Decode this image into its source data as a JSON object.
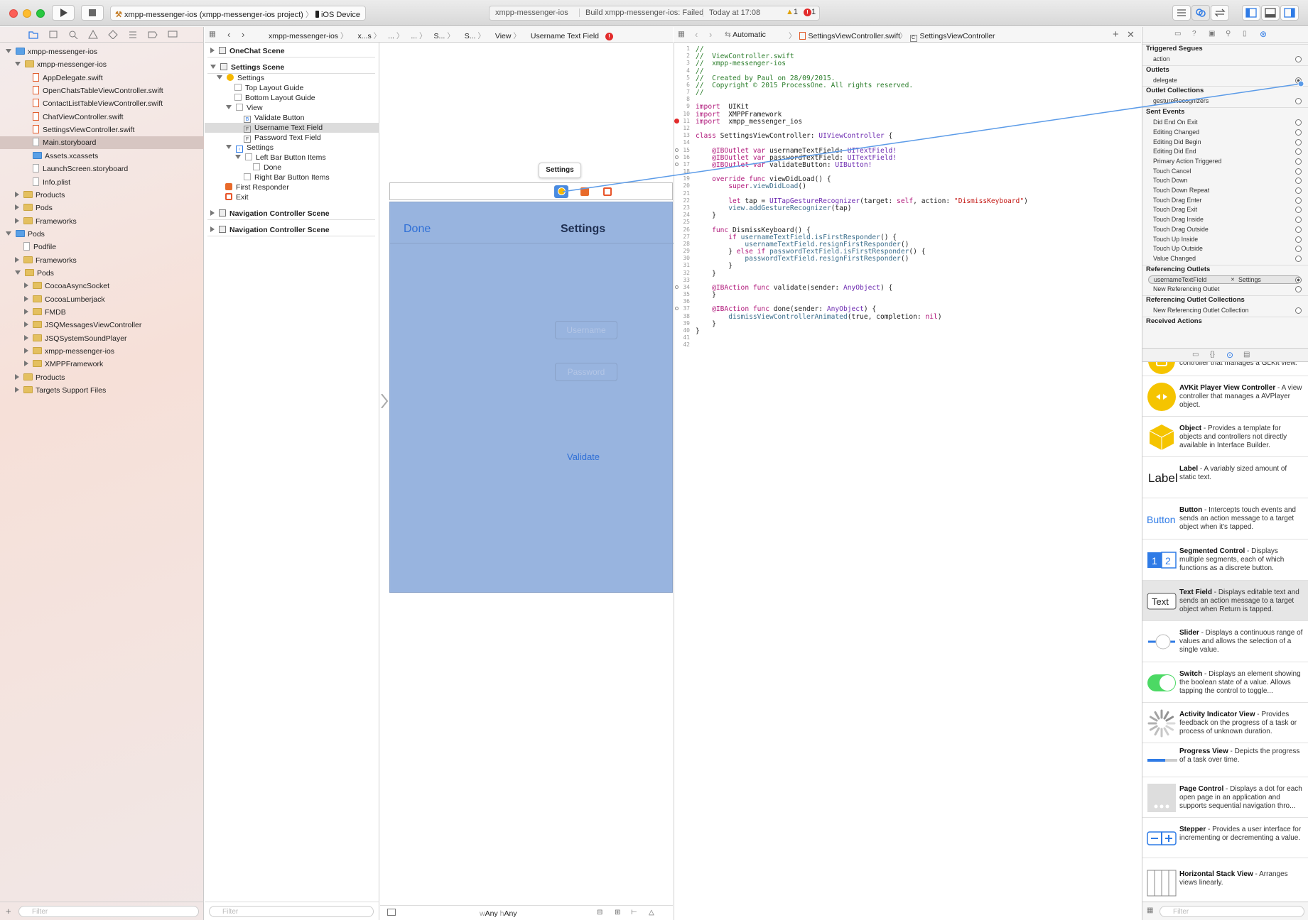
{
  "toolbar": {
    "scheme": "xmpp-messenger-ios (xmpp-messenger-ios project)",
    "device": "iOS Device",
    "activity_project": "xmpp-messenger-ios",
    "activity_status": "Build xmpp-messenger-ios: Failed",
    "activity_time": "Today at 17:08",
    "warnings": "1",
    "errors": "1"
  },
  "navigator": {
    "items": [
      {
        "label": "xmpp-messenger-ios",
        "depth": 0,
        "kind": "project",
        "tri": "open"
      },
      {
        "label": "xmpp-messenger-ios",
        "depth": 1,
        "kind": "folder",
        "tri": "open"
      },
      {
        "label": "AppDelegate.swift",
        "depth": 2,
        "kind": "swift"
      },
      {
        "label": "OpenChatsTableViewController.swift",
        "depth": 2,
        "kind": "swift"
      },
      {
        "label": "ContactListTableViewController.swift",
        "depth": 2,
        "kind": "swift"
      },
      {
        "label": "ChatViewController.swift",
        "depth": 2,
        "kind": "swift"
      },
      {
        "label": "SettingsViewController.swift",
        "depth": 2,
        "kind": "swift"
      },
      {
        "label": "Main.storyboard",
        "depth": 2,
        "kind": "file",
        "selected": true
      },
      {
        "label": "Assets.xcassets",
        "depth": 2,
        "kind": "bluefolder"
      },
      {
        "label": "LaunchScreen.storyboard",
        "depth": 2,
        "kind": "file"
      },
      {
        "label": "Info.plist",
        "depth": 2,
        "kind": "file"
      },
      {
        "label": "Products",
        "depth": 1,
        "kind": "folder",
        "tri": "closed"
      },
      {
        "label": "Pods",
        "depth": 1,
        "kind": "folder",
        "tri": "closed"
      },
      {
        "label": "Frameworks",
        "depth": 1,
        "kind": "folder",
        "tri": "closed"
      },
      {
        "label": "Pods",
        "depth": 0,
        "kind": "project",
        "tri": "open"
      },
      {
        "label": "Podfile",
        "depth": 1,
        "kind": "file"
      },
      {
        "label": "Frameworks",
        "depth": 1,
        "kind": "folder",
        "tri": "closed"
      },
      {
        "label": "Pods",
        "depth": 1,
        "kind": "folder",
        "tri": "open"
      },
      {
        "label": "CocoaAsyncSocket",
        "depth": 2,
        "kind": "folder",
        "tri": "closed"
      },
      {
        "label": "CocoaLumberjack",
        "depth": 2,
        "kind": "folder",
        "tri": "closed"
      },
      {
        "label": "FMDB",
        "depth": 2,
        "kind": "folder",
        "tri": "closed"
      },
      {
        "label": "JSQMessagesViewController",
        "depth": 2,
        "kind": "folder",
        "tri": "closed"
      },
      {
        "label": "JSQSystemSoundPlayer",
        "depth": 2,
        "kind": "folder",
        "tri": "closed"
      },
      {
        "label": "xmpp-messenger-ios",
        "depth": 2,
        "kind": "folder",
        "tri": "closed"
      },
      {
        "label": "XMPPFramework",
        "depth": 2,
        "kind": "folder",
        "tri": "closed"
      },
      {
        "label": "Products",
        "depth": 1,
        "kind": "folder",
        "tri": "closed"
      },
      {
        "label": "Targets Support Files",
        "depth": 1,
        "kind": "folder",
        "tri": "closed"
      }
    ],
    "filter_placeholder": "Filter"
  },
  "jumpbar_left": {
    "crumbs": [
      "xmpp-messenger-ios",
      "x...s",
      "...",
      "...",
      "S...",
      "S...",
      "View",
      "Username Text Field"
    ]
  },
  "jumpbar_right": {
    "mode": "Automatic",
    "file": "SettingsViewController.swift",
    "symbol": "SettingsViewController"
  },
  "outline": {
    "items": [
      {
        "label": "OneChat Scene",
        "depth": 0,
        "bold": true,
        "tri": "closed"
      },
      {
        "label": "Settings Scene",
        "depth": 0,
        "bold": true,
        "tri": "open"
      },
      {
        "label": "Settings",
        "depth": 1,
        "tri": "open",
        "icon": "vc"
      },
      {
        "label": "Top Layout Guide",
        "depth": 2,
        "icon": "box"
      },
      {
        "label": "Bottom Layout Guide",
        "depth": 2,
        "icon": "box"
      },
      {
        "label": "View",
        "depth": 2,
        "tri": "open",
        "icon": "box"
      },
      {
        "label": "Validate Button",
        "depth": 3,
        "icon": "B"
      },
      {
        "label": "Username Text Field",
        "depth": 3,
        "icon": "F",
        "selected": true
      },
      {
        "label": "Password Text Field",
        "depth": 3,
        "icon": "F"
      },
      {
        "label": "Settings",
        "depth": 2,
        "tri": "open",
        "icon": "nav"
      },
      {
        "label": "Left Bar Button Items",
        "depth": 3,
        "tri": "open",
        "icon": "box"
      },
      {
        "label": "Done",
        "depth": 4,
        "icon": "box"
      },
      {
        "label": "Right Bar Button Items",
        "depth": 3,
        "icon": "box"
      },
      {
        "label": "First Responder",
        "depth": 1,
        "icon": "fr"
      },
      {
        "label": "Exit",
        "depth": 1,
        "icon": "exit"
      },
      {
        "label": "Navigation Controller Scene",
        "depth": 0,
        "bold": true,
        "tri": "closed"
      },
      {
        "label": "Navigation Controller Scene",
        "depth": 0,
        "bold": true,
        "tri": "closed"
      }
    ],
    "filter_placeholder": "Filter"
  },
  "canvas": {
    "tooltip": "Settings",
    "nav_done": "Done",
    "nav_title": "Settings",
    "username_placeholder": "Username",
    "password_placeholder": "Password",
    "validate": "Validate",
    "size_w": "Any",
    "size_h": "Any",
    "size_w_prefix": "w",
    "size_h_prefix": "h"
  },
  "code": {
    "lines": [
      [
        [
          "cm",
          "//"
        ]
      ],
      [
        [
          "cm",
          "//  ViewController.swift"
        ]
      ],
      [
        [
          "cm",
          "//  xmpp-messenger-ios"
        ]
      ],
      [
        [
          "cm",
          "//"
        ]
      ],
      [
        [
          "cm",
          "//  Created by Paul on 28/09/2015."
        ]
      ],
      [
        [
          "cm",
          "//  Copyright © 2015 ProcessOne. All rights reserved."
        ]
      ],
      [
        [
          "cm",
          "//"
        ]
      ],
      [],
      [
        [
          "kw",
          "import"
        ],
        [
          "",
          "  UIKit"
        ]
      ],
      [
        [
          "kw",
          "import"
        ],
        [
          "",
          "  XMPPFramework"
        ]
      ],
      [
        [
          "kw",
          "import"
        ],
        [
          "",
          "  xmpp_messenger_ios"
        ]
      ],
      [],
      [
        [
          "kw",
          "class"
        ],
        [
          "",
          " SettingsViewController: "
        ],
        [
          "ty",
          "UIViewController"
        ],
        [
          "",
          " {"
        ]
      ],
      [],
      [
        [
          "",
          "    "
        ],
        [
          "kw",
          "@IBOutlet var"
        ],
        [
          "",
          " usernameTextField: "
        ],
        [
          "ty",
          "UITextField!"
        ]
      ],
      [
        [
          "",
          "    "
        ],
        [
          "kw",
          "@IBOutlet var"
        ],
        [
          "",
          " passwordTextField: "
        ],
        [
          "ty",
          "UITextField!"
        ]
      ],
      [
        [
          "",
          "    "
        ],
        [
          "kw",
          "@IBOutlet var"
        ],
        [
          "",
          " validateButton: "
        ],
        [
          "ty",
          "UIButton!"
        ]
      ],
      [],
      [
        [
          "",
          "    "
        ],
        [
          "kw",
          "override func"
        ],
        [
          "",
          " viewDidLoad() {"
        ]
      ],
      [
        [
          "",
          "        "
        ],
        [
          "kw",
          "super"
        ],
        [
          "fn",
          ".viewDidLoad"
        ],
        [
          "",
          "()"
        ]
      ],
      [],
      [
        [
          "",
          "        "
        ],
        [
          "kw",
          "let"
        ],
        [
          "",
          " tap = "
        ],
        [
          "ty",
          "UITapGestureRecognizer"
        ],
        [
          "",
          "(target: "
        ],
        [
          "kw",
          "self"
        ],
        [
          "",
          ", action: "
        ],
        [
          "st",
          "\"DismissKeyboard\""
        ],
        [
          "",
          ")"
        ]
      ],
      [
        [
          "",
          "        "
        ],
        [
          "fn",
          "view.addGestureRecognizer"
        ],
        [
          "",
          "(tap)"
        ]
      ],
      [
        [
          "",
          "    }"
        ]
      ],
      [],
      [
        [
          "",
          "    "
        ],
        [
          "kw",
          "func"
        ],
        [
          "",
          " DismissKeyboard() {"
        ]
      ],
      [
        [
          "",
          "        "
        ],
        [
          "kw",
          "if"
        ],
        [
          "",
          " "
        ],
        [
          "fn",
          "usernameTextField.isFirstResponder"
        ],
        [
          "",
          "() {"
        ]
      ],
      [
        [
          "",
          "            "
        ],
        [
          "fn",
          "usernameTextField.resignFirstResponder"
        ],
        [
          "",
          "()"
        ]
      ],
      [
        [
          "",
          "        } "
        ],
        [
          "kw",
          "else if"
        ],
        [
          "",
          " "
        ],
        [
          "fn",
          "passwordTextField.isFirstResponder"
        ],
        [
          "",
          "() {"
        ]
      ],
      [
        [
          "",
          "            "
        ],
        [
          "fn",
          "passwordTextField.resignFirstResponder"
        ],
        [
          "",
          "()"
        ]
      ],
      [
        [
          "",
          "        }"
        ]
      ],
      [
        [
          "",
          "    }"
        ]
      ],
      [],
      [
        [
          "",
          "    "
        ],
        [
          "kw",
          "@IBAction func"
        ],
        [
          "",
          " validate(sender: "
        ],
        [
          "ty",
          "AnyObject"
        ],
        [
          "",
          ") {"
        ]
      ],
      [
        [
          "",
          "    }"
        ]
      ],
      [],
      [
        [
          "",
          "    "
        ],
        [
          "kw",
          "@IBAction func"
        ],
        [
          "",
          " done(sender: "
        ],
        [
          "ty",
          "AnyObject"
        ],
        [
          "",
          ") {"
        ]
      ],
      [
        [
          "",
          "        "
        ],
        [
          "fn",
          "dismissViewControllerAnimated"
        ],
        [
          "",
          "(true, completion: "
        ],
        [
          "kw",
          "nil"
        ],
        [
          "",
          ")"
        ]
      ],
      [
        [
          "",
          "    }"
        ]
      ],
      [
        [
          "",
          "}"
        ]
      ],
      [],
      []
    ]
  },
  "inspector": {
    "sections": [
      {
        "title": "Triggered Segues",
        "rows": [
          {
            "label": "action"
          }
        ]
      },
      {
        "title": "Outlets",
        "rows": [
          {
            "label": "delegate",
            "connected": true
          }
        ]
      },
      {
        "title": "Outlet Collections",
        "rows": [
          {
            "label": "gestureRecognizers"
          }
        ]
      },
      {
        "title": "Sent Events",
        "rows": [
          {
            "label": "Did End On Exit"
          },
          {
            "label": "Editing Changed"
          },
          {
            "label": "Editing Did Begin"
          },
          {
            "label": "Editing Did End"
          },
          {
            "label": "Primary Action Triggered"
          },
          {
            "label": "Touch Cancel"
          },
          {
            "label": "Touch Down"
          },
          {
            "label": "Touch Down Repeat"
          },
          {
            "label": "Touch Drag Enter"
          },
          {
            "label": "Touch Drag Exit"
          },
          {
            "label": "Touch Drag Inside"
          },
          {
            "label": "Touch Drag Outside"
          },
          {
            "label": "Touch Up Inside"
          },
          {
            "label": "Touch Up Outside"
          },
          {
            "label": "Value Changed"
          }
        ]
      },
      {
        "title": "Referencing Outlets",
        "rows": [
          {
            "label": "usernameTextField",
            "pill": "Settings",
            "connected": true
          },
          {
            "label": "New Referencing Outlet"
          }
        ]
      },
      {
        "title": "Referencing Outlet Collections",
        "rows": [
          {
            "label": "New Referencing Outlet Collection"
          }
        ]
      },
      {
        "title": "Received Actions",
        "rows": []
      }
    ],
    "library": [
      {
        "name": "",
        "desc": "controller that manages a GLKit view.",
        "icon": "glkit-icon"
      },
      {
        "name": "AVKit Player View Controller",
        "desc": " - A view controller that manages a AVPlayer object.",
        "icon": "avkit-icon"
      },
      {
        "name": "Object",
        "desc": " - Provides a template for objects and controllers not directly available in Interface Builder.",
        "icon": "object-icon"
      },
      {
        "name": "Label",
        "desc": " - A variably sized amount of static text.",
        "icon": "label-icon",
        "glyph": "Label"
      },
      {
        "name": "Button",
        "desc": " - Intercepts touch events and sends an action message to a target object when it's tapped.",
        "icon": "button-icon",
        "glyph": "Button"
      },
      {
        "name": "Segmented Control",
        "desc": " - Displays multiple segments, each of which functions as a discrete button.",
        "icon": "segmented-icon",
        "glyph": "1 2"
      },
      {
        "name": "Text Field",
        "desc": " - Displays editable text and sends an action message to a target object when Return is tapped.",
        "icon": "textfield-icon",
        "glyph": "Text"
      },
      {
        "name": "Slider",
        "desc": " - Displays a continuous range of values and allows the selection of a single value.",
        "icon": "slider-icon"
      },
      {
        "name": "Switch",
        "desc": " - Displays an element showing the boolean state of a value. Allows tapping the control to toggle...",
        "icon": "switch-icon"
      },
      {
        "name": "Activity Indicator View",
        "desc": " - Provides feedback on the progress of a task or process of unknown duration.",
        "icon": "activity-icon"
      },
      {
        "name": "Progress View",
        "desc": " - Depicts the progress of a task over time.",
        "icon": "progress-icon"
      },
      {
        "name": "Page Control",
        "desc": " - Displays a dot for each open page in an application and supports sequential navigation thro...",
        "icon": "pagecontrol-icon"
      },
      {
        "name": "Stepper",
        "desc": " - Provides a user interface for incrementing or decrementing a value.",
        "icon": "stepper-icon"
      },
      {
        "name": "Horizontal Stack View",
        "desc": " - Arranges views linearly.",
        "icon": "hstack-icon"
      }
    ],
    "filter_placeholder": "Filter"
  },
  "colors": {
    "accent": "#2f7be6",
    "error": "#e22b2b",
    "warning": "#f5b700",
    "canvas_view": "#98b4df"
  }
}
